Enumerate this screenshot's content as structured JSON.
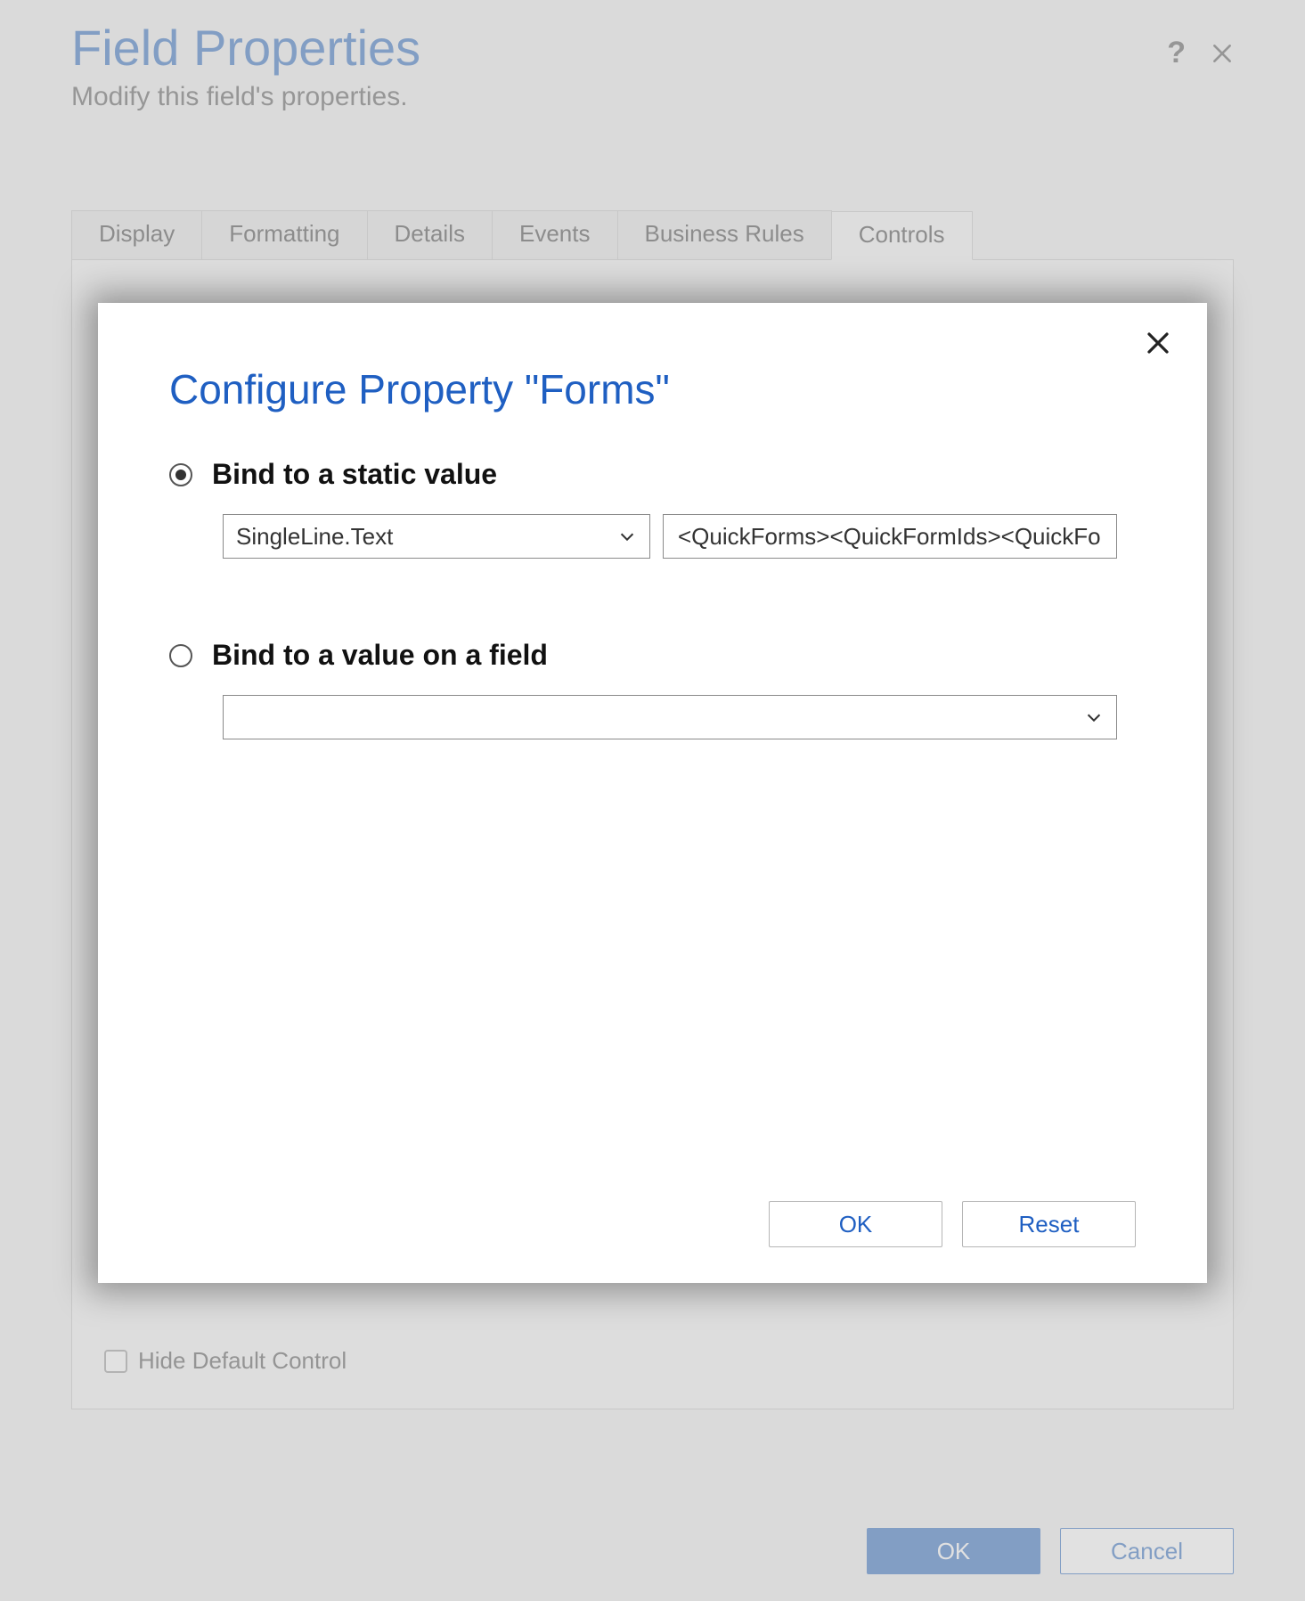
{
  "dialog": {
    "title": "Field Properties",
    "subtitle": "Modify this field's properties.",
    "tabs": {
      "display": "Display",
      "formatting": "Formatting",
      "details": "Details",
      "events": "Events",
      "business_rules": "Business Rules",
      "controls": "Controls"
    },
    "hide_default_control_label": "Hide Default Control",
    "ok_label": "OK",
    "cancel_label": "Cancel"
  },
  "modal": {
    "title": "Configure Property \"Forms\"",
    "option_static": {
      "label": "Bind to a static value",
      "type_select_value": "SingleLine.Text",
      "value_input": "<QuickForms><QuickFormIds><QuickFo"
    },
    "option_field": {
      "label": "Bind to a value on a field",
      "select_value": ""
    },
    "ok_label": "OK",
    "reset_label": "Reset"
  }
}
